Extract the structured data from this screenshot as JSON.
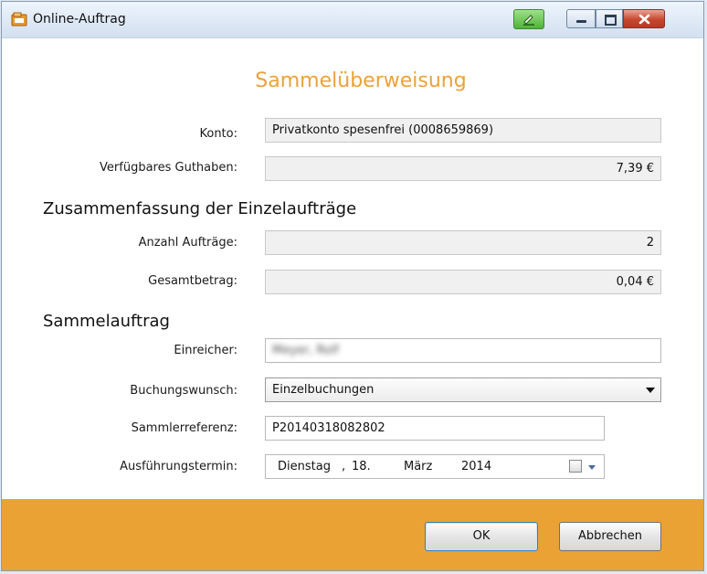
{
  "window": {
    "title": "Online-Auftrag"
  },
  "heading": "Sammelüberweisung",
  "account": {
    "konto_label": "Konto:",
    "konto_value": "Privatkonto spesenfrei (0008659869)",
    "guthaben_label": "Verfügbares Guthaben:",
    "guthaben_value": "7,39 €"
  },
  "summary": {
    "title": "Zusammenfassung der Einzelaufträge",
    "anzahl_label": "Anzahl Aufträge:",
    "anzahl_value": "2",
    "gesamt_label": "Gesamtbetrag:",
    "gesamt_value": "0,04 €"
  },
  "order": {
    "title": "Sammelauftrag",
    "einreicher_label": "Einreicher:",
    "einreicher_value": "Meyer, Rolf",
    "buchung_label": "Buchungswunsch:",
    "buchung_value": "Einzelbuchungen",
    "referenz_label": "Sammlerreferenz:",
    "referenz_value": "P20140318082802",
    "termin_label": "Ausführungstermin:",
    "termin_weekday": "Dienstag",
    "termin_sep": ",",
    "termin_day": "18.",
    "termin_month": "März",
    "termin_year": "2014"
  },
  "buttons": {
    "ok": "OK",
    "cancel": "Abbrechen"
  },
  "colors": {
    "accent": "#eaa234",
    "heading": "#eaa23a"
  }
}
